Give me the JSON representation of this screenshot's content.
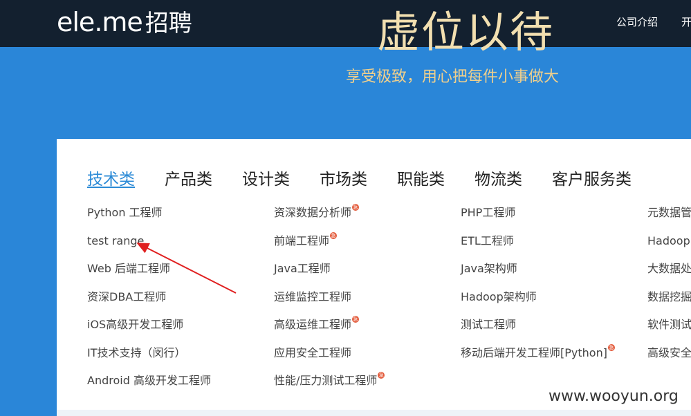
{
  "header": {
    "logo_text": "ele.me",
    "logo_suffix": "招聘",
    "nav": [
      "公司介绍",
      "开"
    ]
  },
  "hero": {
    "title": "虚位以待",
    "subtitle": "享受极致，用心把每件小事做大"
  },
  "tabs": [
    {
      "label": "技术类",
      "active": true
    },
    {
      "label": "产品类",
      "active": false
    },
    {
      "label": "设计类",
      "active": false
    },
    {
      "label": "市场类",
      "active": false
    },
    {
      "label": "职能类",
      "active": false
    },
    {
      "label": "物流类",
      "active": false
    },
    {
      "label": "客户服务类",
      "active": false
    }
  ],
  "hot_badge": "急",
  "columns": [
    [
      {
        "title": "Python 工程师",
        "hot": false
      },
      {
        "title": "test range",
        "hot": false
      },
      {
        "title": "Web 后端工程师",
        "hot": false
      },
      {
        "title": "资深DBA工程师",
        "hot": false
      },
      {
        "title": "iOS高级开发工程师",
        "hot": false
      },
      {
        "title": "IT技术支持（闵行）",
        "hot": false
      },
      {
        "title": "Android 高级开发工程师",
        "hot": false
      }
    ],
    [
      {
        "title": "资深数据分析师",
        "hot": true
      },
      {
        "title": "前端工程师",
        "hot": true
      },
      {
        "title": "Java工程师",
        "hot": false
      },
      {
        "title": "运维监控工程师",
        "hot": false
      },
      {
        "title": "高级运维工程师",
        "hot": true
      },
      {
        "title": "应用安全工程师",
        "hot": false
      },
      {
        "title": "性能/压力测试工程师",
        "hot": true
      }
    ],
    [
      {
        "title": "PHP工程师",
        "hot": false
      },
      {
        "title": "ETL工程师",
        "hot": false
      },
      {
        "title": "Java架构师",
        "hot": false
      },
      {
        "title": "Hadoop架构师",
        "hot": false
      },
      {
        "title": "测试工程师",
        "hot": false
      },
      {
        "title": "移动后端开发工程师[Python]",
        "hot": true
      }
    ],
    [
      {
        "title": "元数据管",
        "hot": false
      },
      {
        "title": "Hadoop",
        "hot": false
      },
      {
        "title": "大数据处",
        "hot": false
      },
      {
        "title": "数据挖掘",
        "hot": false
      },
      {
        "title": "软件测试",
        "hot": false
      },
      {
        "title": "高级安全",
        "hot": false
      }
    ]
  ],
  "annotation": {
    "color": "#e02020"
  },
  "watermark": "www.wooyun.org",
  "colors": {
    "accent": "#2b8ad6",
    "hero_bg": "#2a86d8",
    "topbar": "#13202f"
  }
}
